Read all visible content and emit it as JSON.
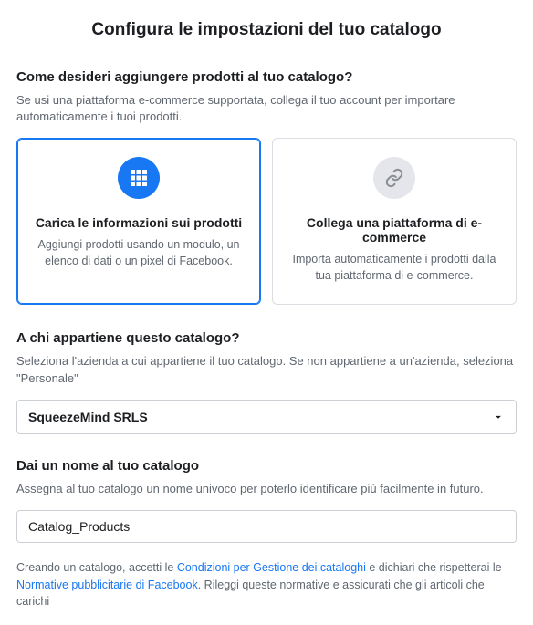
{
  "page_title": "Configura le impostazioni del tuo catalogo",
  "section1": {
    "heading": "Come desideri aggiungere prodotti al tuo catalogo?",
    "desc": "Se usi una piattaforma e-commerce supportata, collega il tuo account per importare automaticamente i tuoi prodotti."
  },
  "cards": {
    "upload": {
      "title": "Carica le informazioni sui prodotti",
      "desc": "Aggiungi prodotti usando un modulo, un elenco di dati o un pixel di Facebook."
    },
    "connect": {
      "title": "Collega una piattaforma di e-commerce",
      "desc": "Importa automaticamente i prodotti dalla tua piattaforma di e-commerce."
    }
  },
  "section2": {
    "heading": "A chi appartiene questo catalogo?",
    "desc": "Seleziona l'azienda a cui appartiene il tuo catalogo. Se non appartiene a un'azienda, seleziona \"Personale\""
  },
  "owner_select": {
    "value": "SqueezeMind SRLS"
  },
  "section3": {
    "heading": "Dai un nome al tuo catalogo",
    "desc": "Assegna al tuo catalogo un nome univoco per poterlo identificare più facilmente in futuro."
  },
  "catalog_name": {
    "value": "Catalog_Products"
  },
  "disclaimer": {
    "t1": "Creando un catalogo, accetti le ",
    "link1": "Condizioni per Gestione dei cataloghi",
    "t2": " e dichiari che rispetterai le ",
    "link2": "Normative pubblicitarie di Facebook",
    "t3": ". Rileggi queste normative e assicurati che gli articoli che carichi"
  }
}
